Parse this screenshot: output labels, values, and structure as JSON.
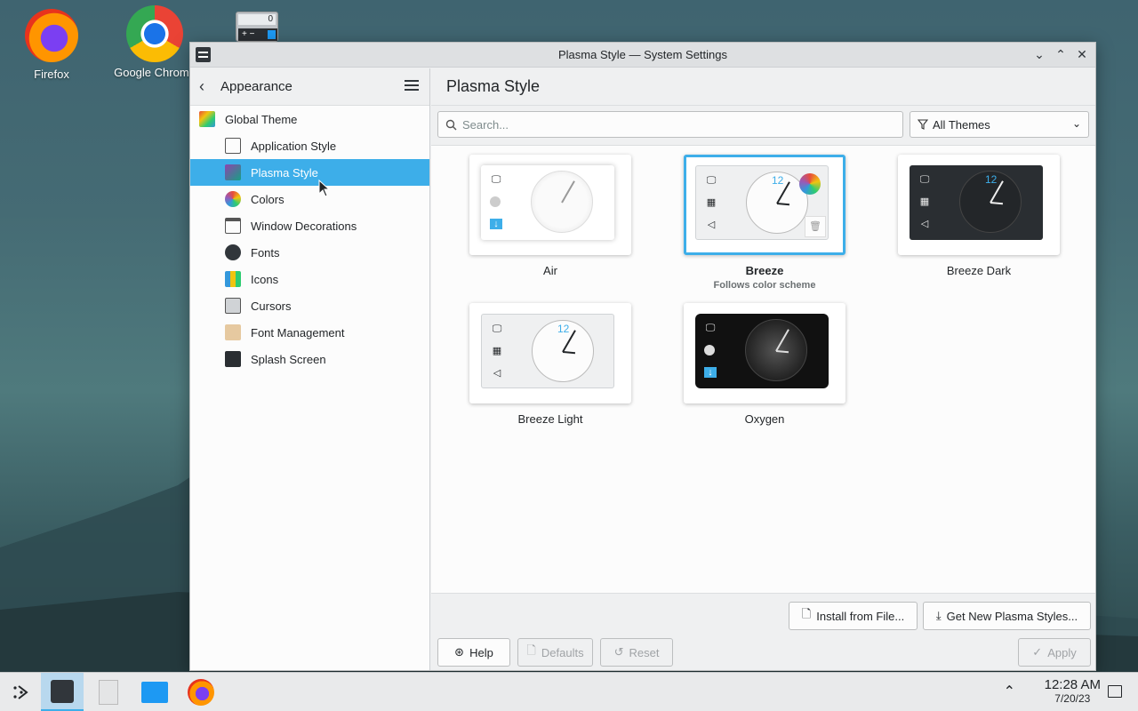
{
  "desktop": {
    "icons": [
      {
        "label": "Firefox",
        "icon": "firefox-icon"
      },
      {
        "label": "Google Chrome",
        "icon": "chrome-icon"
      }
    ],
    "calculator_display": "0",
    "calculator_keys": "+ −"
  },
  "window": {
    "title": "Plasma Style — System Settings",
    "controls": {
      "minimize": "⌄",
      "maximize": "⌃",
      "close": "✕"
    }
  },
  "sidebar": {
    "header": "Appearance",
    "items": [
      {
        "label": "Global Theme",
        "icon": "global-theme-icon",
        "level": "top"
      },
      {
        "label": "Application Style",
        "icon": "application-style-icon",
        "level": "sub"
      },
      {
        "label": "Plasma Style",
        "icon": "plasma-style-icon",
        "level": "sub",
        "active": true
      },
      {
        "label": "Colors",
        "icon": "colors-icon",
        "level": "sub"
      },
      {
        "label": "Window Decorations",
        "icon": "window-decorations-icon",
        "level": "sub"
      },
      {
        "label": "Fonts",
        "icon": "fonts-icon",
        "level": "sub"
      },
      {
        "label": "Icons",
        "icon": "icons-icon",
        "level": "sub"
      },
      {
        "label": "Cursors",
        "icon": "cursors-icon",
        "level": "sub"
      },
      {
        "label": "Font Management",
        "icon": "font-management-icon",
        "level": "sub"
      },
      {
        "label": "Splash Screen",
        "icon": "splash-screen-icon",
        "level": "sub"
      }
    ]
  },
  "content": {
    "title": "Plasma Style",
    "search": {
      "placeholder": "Search...",
      "value": ""
    },
    "filter": {
      "selected": "All Themes"
    },
    "themes": [
      {
        "name": "Air",
        "subtitle": "",
        "selected": false
      },
      {
        "name": "Breeze",
        "subtitle": "Follows color scheme",
        "selected": true
      },
      {
        "name": "Breeze Dark",
        "subtitle": "",
        "selected": false
      },
      {
        "name": "Breeze Light",
        "subtitle": "",
        "selected": false
      },
      {
        "name": "Oxygen",
        "subtitle": "",
        "selected": false
      }
    ],
    "clock_numeral": "12",
    "buttons": {
      "install": "Install from File...",
      "get_new": "Get New Plasma Styles...",
      "help": "Help",
      "defaults": "Defaults",
      "reset": "Reset",
      "apply": "Apply"
    }
  },
  "taskbar": {
    "time": "12:28 AM",
    "date": "7/20/23"
  },
  "colors": {
    "accent": "#3daee9",
    "window_bg": "#eff0f1",
    "view_bg": "#fcfcfc",
    "text": "#232629"
  }
}
